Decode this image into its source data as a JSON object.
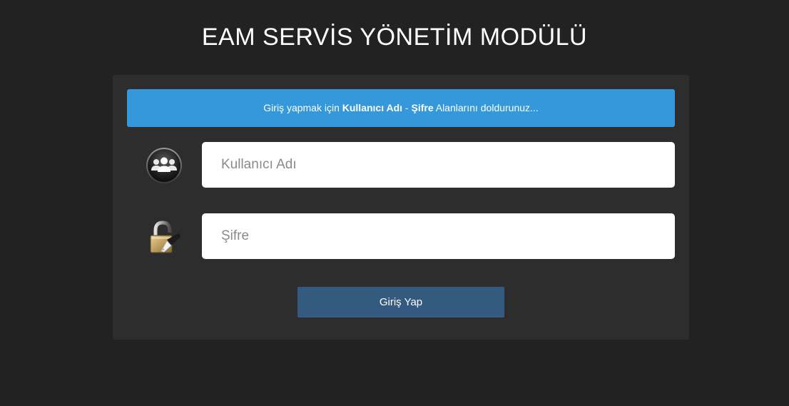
{
  "page": {
    "title": "EAM SERVİS YÖNETİM MODÜLÜ"
  },
  "info": {
    "prefix": "Giriş yapmak için ",
    "username_word": "Kullanıcı Adı",
    "separator": " - ",
    "password_word": "Şifre",
    "suffix": " Alanlarını doldurunuz..."
  },
  "form": {
    "username": {
      "icon": "users-icon",
      "placeholder": "Kullanıcı Adı",
      "value": ""
    },
    "password": {
      "icon": "padlock-icon",
      "placeholder": "Şifre",
      "value": ""
    },
    "submit_label": "Giriş Yap"
  },
  "colors": {
    "background": "#222222",
    "panel": "#2d2d2d",
    "info_bar": "#3498db",
    "button": "#355a80"
  }
}
